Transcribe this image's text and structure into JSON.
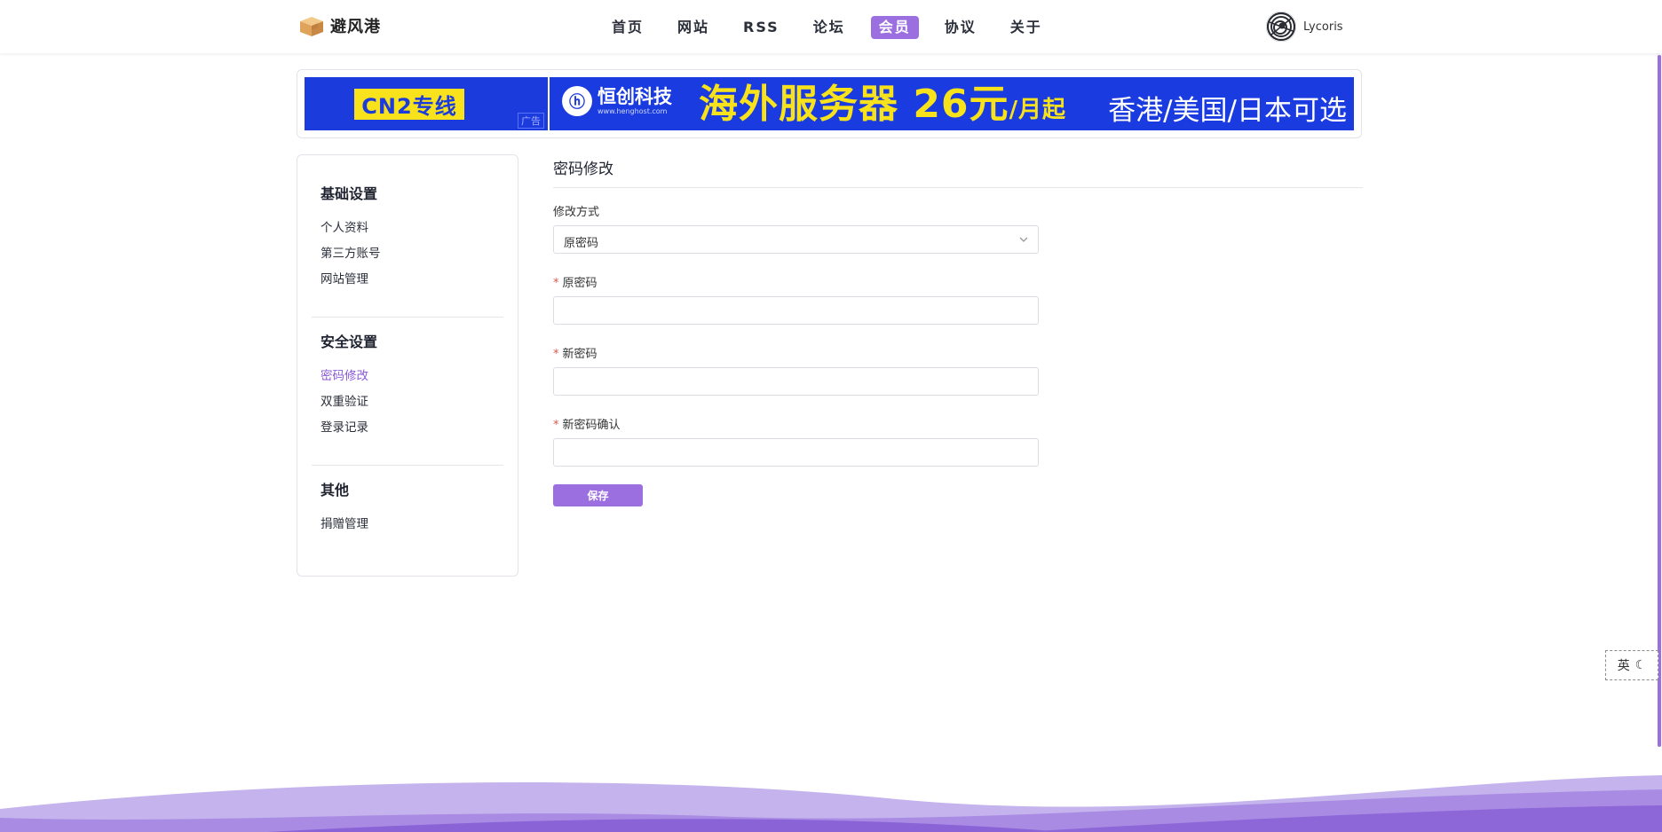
{
  "header": {
    "site_name": "避风港",
    "nav": [
      {
        "label": "首页",
        "active": false
      },
      {
        "label": "网站",
        "active": false
      },
      {
        "label": "RSS",
        "active": false
      },
      {
        "label": "论坛",
        "active": false
      },
      {
        "label": "会员",
        "active": true
      },
      {
        "label": "协议",
        "active": false
      },
      {
        "label": "关于",
        "active": false
      }
    ],
    "username": "Lycoris"
  },
  "ad": {
    "left_text": "CN2专线",
    "tag": "广告",
    "brand_name": "恒创科技",
    "brand_url": "www.henghost.com",
    "headline_main": "海外服务器 26元",
    "headline_small": "/月起",
    "sub": "香港/美国/日本可选"
  },
  "sidebar": {
    "groups": [
      {
        "title": "基础设置",
        "items": [
          "个人资料",
          "第三方账号",
          "网站管理"
        ]
      },
      {
        "title": "安全设置",
        "items": [
          "密码修改",
          "双重验证",
          "登录记录"
        ]
      },
      {
        "title": "其他",
        "items": [
          "捐赠管理"
        ]
      }
    ],
    "active_item": "密码修改"
  },
  "form": {
    "title": "密码修改",
    "method_label": "修改方式",
    "method_value": "原密码",
    "old_password_label": "原密码",
    "new_password_label": "新密码",
    "confirm_password_label": "新密码确认",
    "required_mark": "*",
    "save_label": "保存"
  },
  "widget": {
    "lang": "英",
    "mode_icon": "moon-icon"
  },
  "colors": {
    "accent": "#9b6fe0",
    "ad_blue": "#1b3bdc",
    "ad_yellow": "#f7e21b",
    "required": "#e2574c"
  }
}
